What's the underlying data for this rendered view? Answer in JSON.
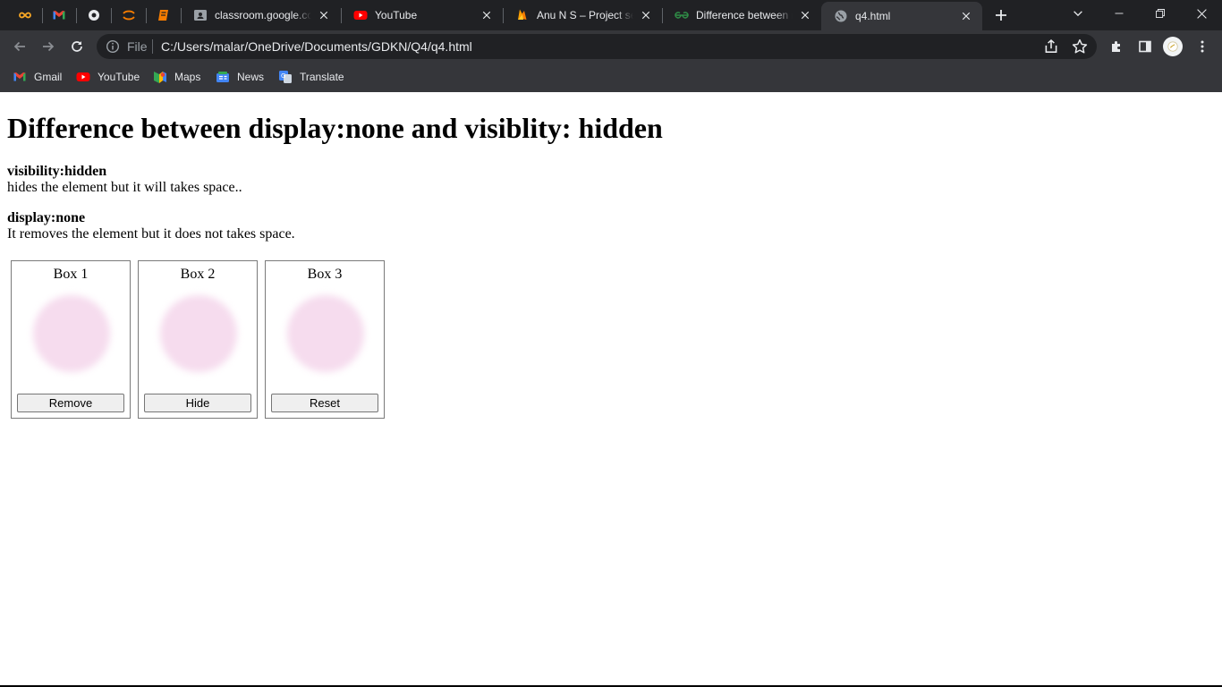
{
  "browser": {
    "tabs": [
      {
        "title": "classroom.google.com",
        "icon": "classroom-icon"
      },
      {
        "title": "YouTube",
        "icon": "youtube-icon"
      },
      {
        "title": "Anu N S – Project settings",
        "icon": "firebase-icon"
      },
      {
        "title": "Difference between remove",
        "icon": "geeksforgeeks-icon"
      },
      {
        "title": "q4.html",
        "icon": "globe-icon",
        "active": true
      }
    ],
    "pinned_tabs": [
      "infinity-icon",
      "gmail-icon",
      "puzzle-icon",
      "arc-icon",
      "book-icon"
    ],
    "address_bar": {
      "scheme_label": "File",
      "url": "C:/Users/malar/OneDrive/Documents/GDKN/Q4/q4.html"
    },
    "bookmarks": [
      {
        "label": "Gmail",
        "icon": "gmail-icon"
      },
      {
        "label": "YouTube",
        "icon": "youtube-icon"
      },
      {
        "label": "Maps",
        "icon": "maps-icon"
      },
      {
        "label": "News",
        "icon": "news-icon"
      },
      {
        "label": "Translate",
        "icon": "translate-icon"
      }
    ]
  },
  "page": {
    "heading": "Difference between display:none and visiblity: hidden",
    "definitions": [
      {
        "term": "visibility:hidden",
        "description": "hides the element but it will takes space.."
      },
      {
        "term": "display:none",
        "description": "It removes the element but it does not takes space."
      }
    ],
    "boxes": [
      {
        "label": "Box 1",
        "button": "Remove"
      },
      {
        "label": "Box 2",
        "button": "Hide"
      },
      {
        "label": "Box 3",
        "button": "Reset"
      }
    ]
  },
  "colors": {
    "tab_strip": "#202124",
    "toolbar": "#35363a",
    "blob": "#f6dcee"
  }
}
